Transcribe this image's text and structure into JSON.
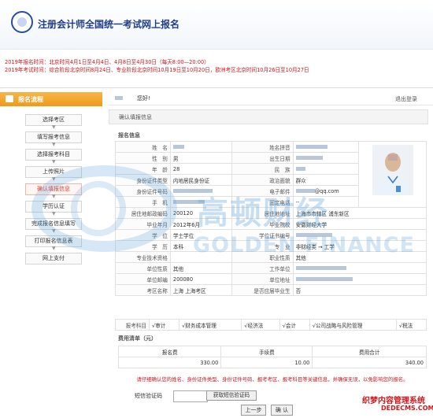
{
  "header": {
    "title": "注册会计师全国统一考试网上报名"
  },
  "notices": [
    "2019年报名时间：北京时间4月1日至4月4日、4月8日至4月30日（每天8:00—20:00）",
    "2019年考试时间：综合阶段北京时间8月24日、专业阶段北京时间10月19日至10月20日，欧洲考区北京时间10月26日至10月27日"
  ],
  "sidebar": {
    "title": "报名流程",
    "steps": [
      "选择考区",
      "填写报考信息",
      "选择报考科目",
      "上传照片",
      "确认填报信息",
      "学历认证",
      "完成报名信息填写",
      "打印报名信息表",
      "网上支付"
    ]
  },
  "main": {
    "greeting": "您好!",
    "logout": "退出登录",
    "section_title": "确认填报信息",
    "info_label": "报名信息",
    "rows": [
      {
        "l1": "姓　名",
        "v1": "",
        "l2": "姓名拼音",
        "v2": ""
      },
      {
        "l1": "性　别",
        "v1": "男",
        "l2": "出生日期",
        "v2": ""
      },
      {
        "l1": "年　龄",
        "v1": "28",
        "l2": "民　族",
        "v2": ""
      },
      {
        "l1": "身份证件类型",
        "v1": "内地居民身份证",
        "l2": "政治面貌",
        "v2": "群众"
      },
      {
        "l1": "身份证件号码",
        "v1": "",
        "l2": "电子邮件",
        "v2": "@qq.com"
      },
      {
        "l1": "手　机",
        "v1": "",
        "l2": "固定电话",
        "v2": "--"
      },
      {
        "l1": "居住地邮政编码",
        "v1": "200120",
        "l2": "居住地地址",
        "v2": "上海市市辖区 浦东新区"
      },
      {
        "l1": "毕业年月",
        "v1": "2012年6月",
        "l2": "毕业院校",
        "v2": "安徽财经大学"
      },
      {
        "l1": "学　位",
        "v1": "学士学位",
        "l2": "学位证书编号",
        "v2": ""
      },
      {
        "l1": "学　历",
        "v1": "本科",
        "l2": "专　业",
        "v2": "非财经类 → 工学"
      },
      {
        "l1": "专业技术资格",
        "v1": "",
        "l2": "职业性质",
        "v2": "其他"
      },
      {
        "l1": "单位性质",
        "v1": "其他",
        "l2": "工作单位",
        "v2": ""
      },
      {
        "l1": "单位邮编",
        "v1": "200080",
        "l2": "单位地址",
        "v2": ""
      },
      {
        "l1": "考区名称",
        "v1": "上海 上海考区",
        "l2": "是否应届毕业生",
        "v2": "否"
      }
    ],
    "subjects_label": "报考科目",
    "subjects": [
      "√审计",
      "√财务成本管理",
      "√经济法",
      "√会计",
      "√公司战略与风险管理",
      "√税法"
    ],
    "fee_label": "费用清单（元）",
    "fee_headers": [
      "报名费",
      "手续费",
      "费用合计"
    ],
    "fee_values": [
      "330.00",
      "10.00",
      "340.00"
    ],
    "warning": "请仔细确认您的姓名、身份证件类型、身份证件号码、报考考区、报考科目等关键信息，并确保无误，以免影响您的报名。",
    "sms_label": "短信验证码",
    "sms_button": "获取短信验证码",
    "prev_button": "上一步",
    "confirm_button": "确 认"
  },
  "watermark": {
    "cn": "高顿财经",
    "en": "GOLDEN FINANCE"
  },
  "brand": {
    "title": "织梦内容管理系统",
    "url": "DEDECMS.COM"
  },
  "colors": {
    "accent": "#ee9a18",
    "notice": "#d0161b",
    "title": "#1f3e88"
  }
}
